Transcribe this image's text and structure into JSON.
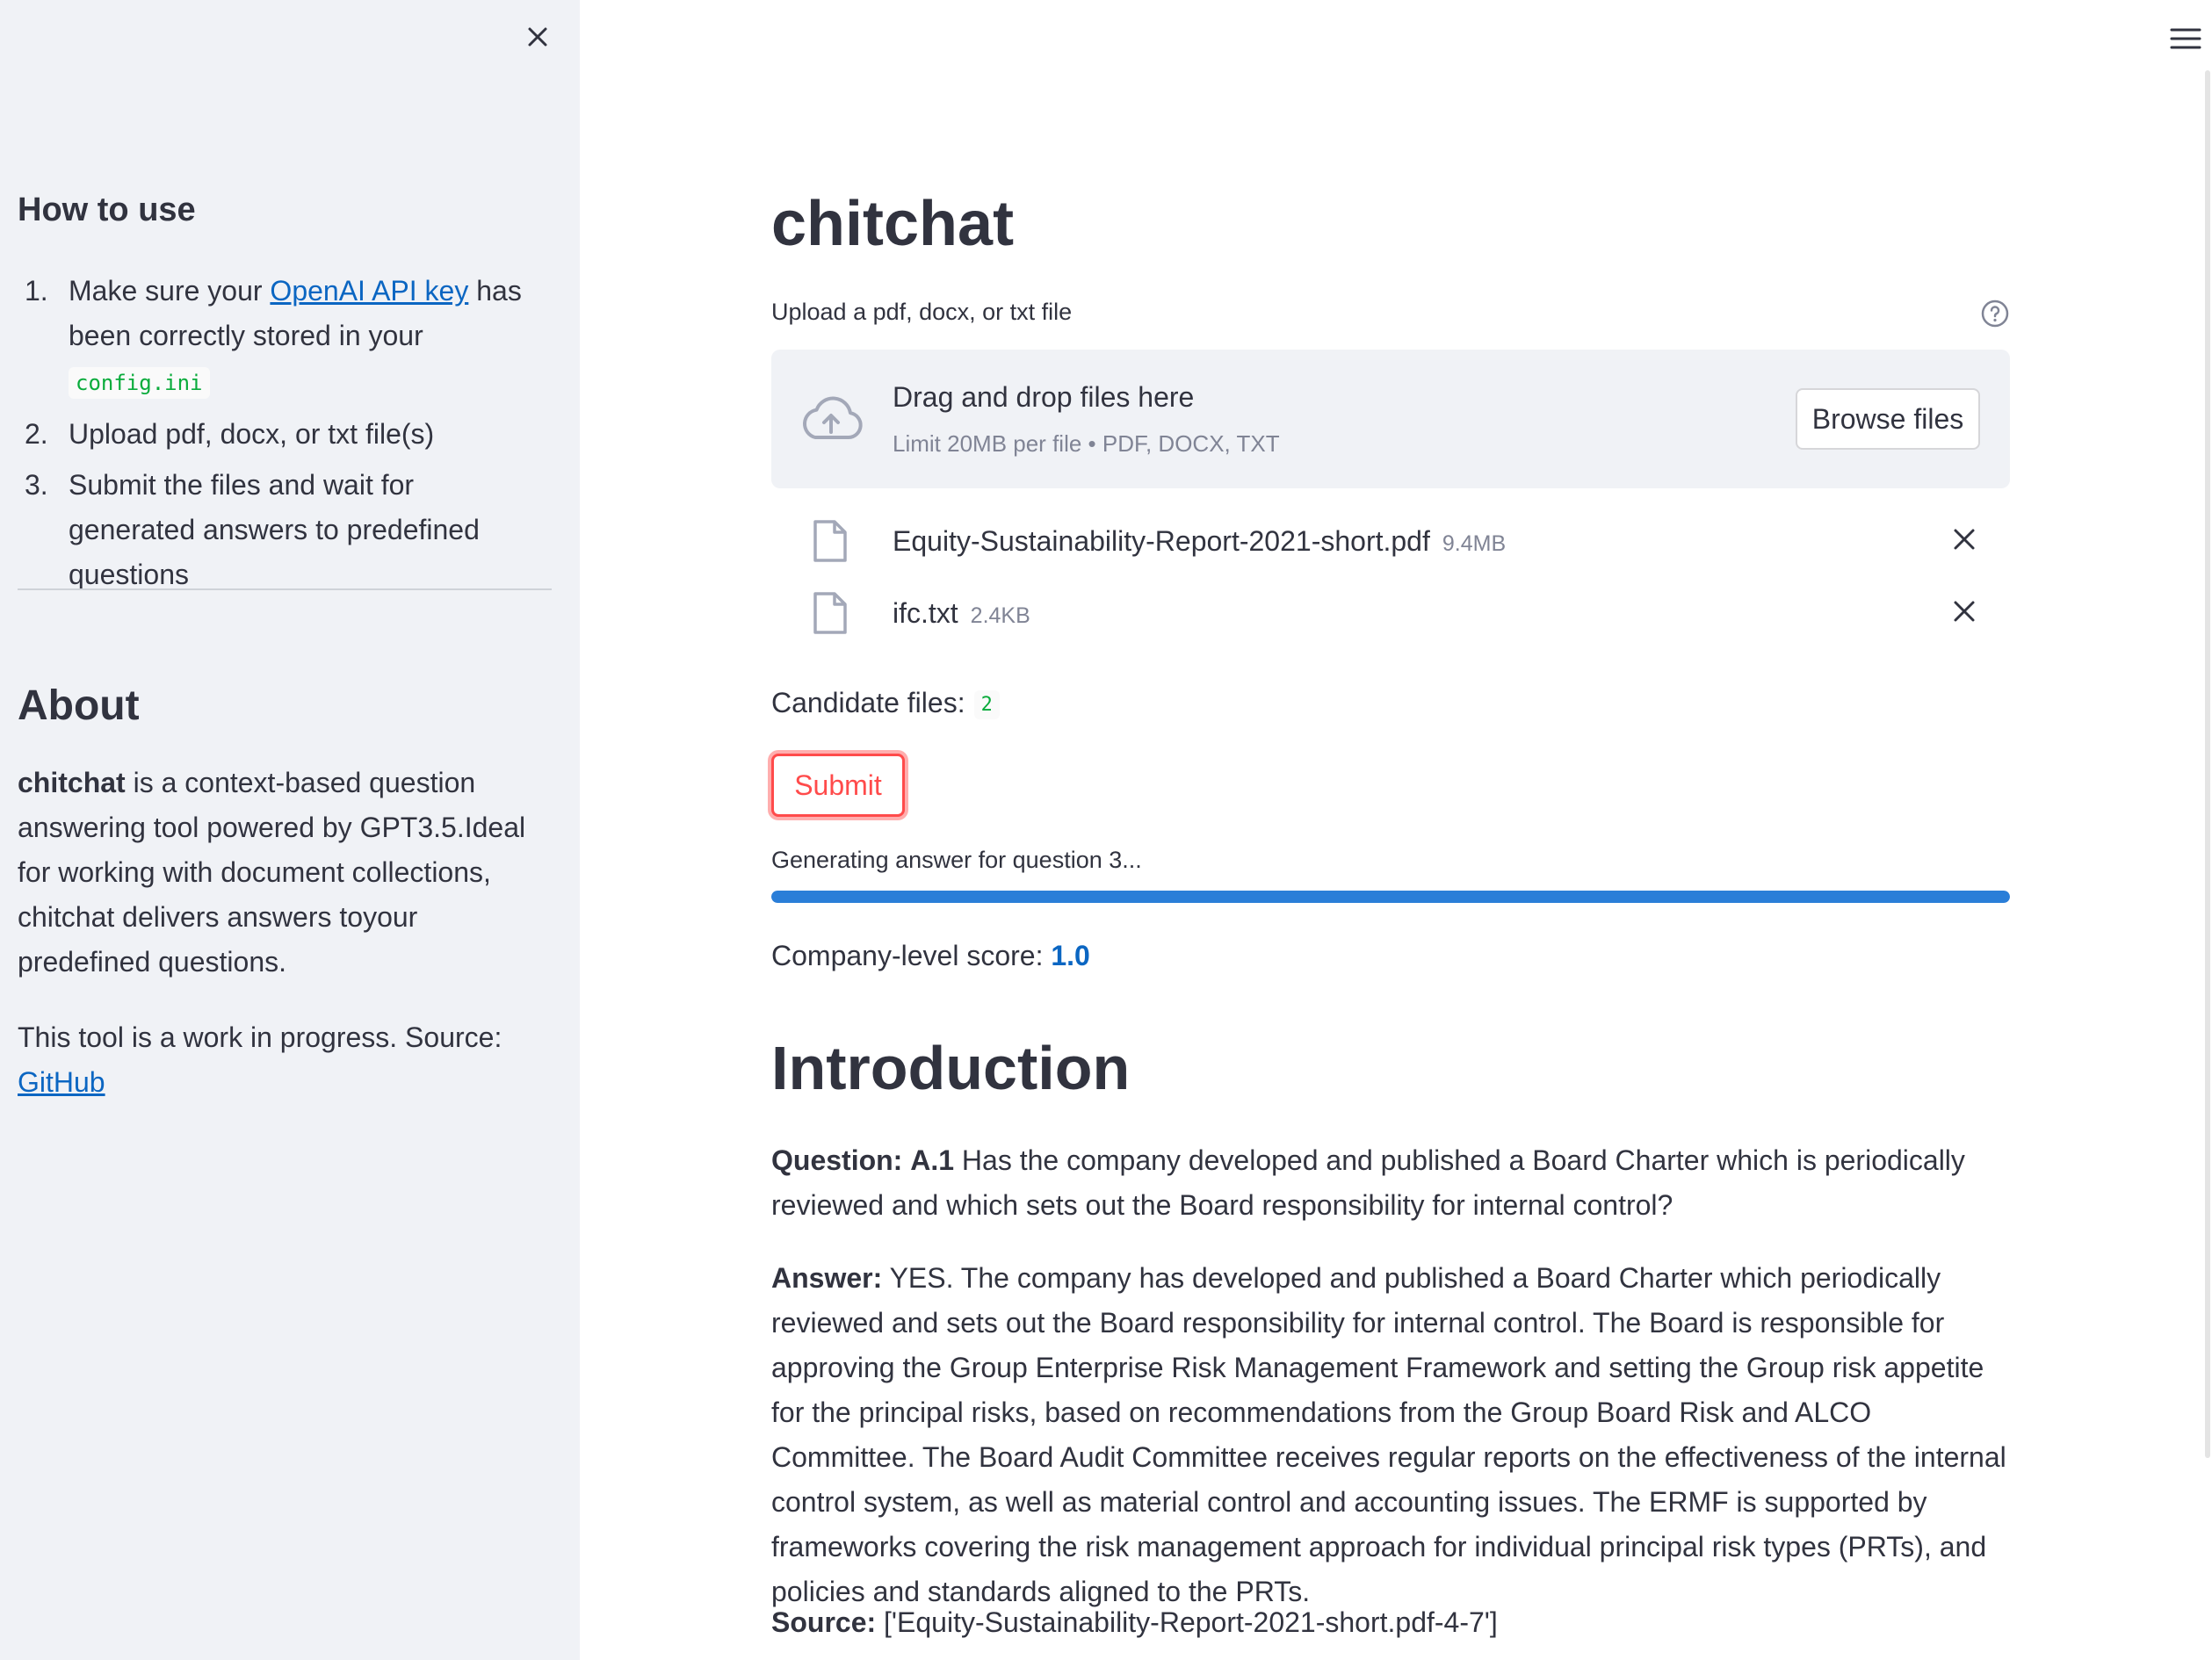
{
  "sidebar": {
    "how_to_title": "How to use",
    "steps": [
      {
        "num": "1.",
        "pre": "Make sure your ",
        "link": "OpenAI API key",
        "post": " has been correctly stored in your ",
        "code": "config.ini"
      },
      {
        "num": "2.",
        "text": "Upload pdf, docx, or txt file(s)"
      },
      {
        "num": "3.",
        "text": "Submit the files and wait for generated answers to predefined questions"
      }
    ],
    "about_title": "About",
    "about_bold": "chitchat",
    "about_text": " is a context-based question answering tool powered by GPT3.5.Ideal for working with document collections, chitchat delivers answers toyour predefined questions.",
    "wip_text": "This tool is a work in progress. Source:",
    "github_link": "GitHub"
  },
  "main": {
    "title": "chitchat",
    "uploader": {
      "label": "Upload a pdf, docx, or txt file",
      "drop_title": "Drag and drop files here",
      "drop_subtitle": "Limit 20MB per file • PDF, DOCX, TXT",
      "browse_label": "Browse files"
    },
    "files": [
      {
        "name": "Equity-Sustainability-Report-2021-short.pdf",
        "size": "9.4MB"
      },
      {
        "name": "ifc.txt",
        "size": "2.4KB"
      }
    ],
    "candidates_label": "Candidate files:",
    "candidates_count": "2",
    "submit_label": "Submit",
    "progress": {
      "label": "Generating answer for question 3...",
      "value": 1.0
    },
    "score_label": "Company-level score:",
    "score_value": "1.0",
    "section_title": "Introduction",
    "question_label": "Question:",
    "question_id": "A.1",
    "question_text": " Has the company developed and published a Board Charter which is periodically reviewed and which sets out the Board responsibility for internal control?",
    "answer_label": "Answer:",
    "answer_text": " YES. The company has developed and published a Board Charter which periodically reviewed and sets out the Board responsibility for internal control. The Board is responsible for approving the Group Enterprise Risk Management Framework and setting the Group risk appetite for the principal risks, based on recommendations from the Group Board Risk and ALCO Committee. The Board Audit Committee receives regular reports on the effectiveness of the internal control system, as well as material control and accounting issues. The ERMF is supported by frameworks covering the risk management approach for individual principal risk types (PRTs), and policies and standards aligned to the PRTs.",
    "source_label": "Source:",
    "source_text": " ['Equity-Sustainability-Report-2021-short.pdf-4-7']"
  },
  "icons": {
    "close": "close-icon",
    "menu": "hamburger-menu-icon",
    "help": "help-circle-icon",
    "upload": "cloud-upload-icon",
    "file": "file-icon",
    "remove": "remove-file-icon"
  },
  "colors": {
    "accent": "#ff4b4b",
    "link": "#0b66c2",
    "progress": "#2a7ed8",
    "code": "#09ab3b",
    "sidebar_bg": "#f0f2f6"
  }
}
